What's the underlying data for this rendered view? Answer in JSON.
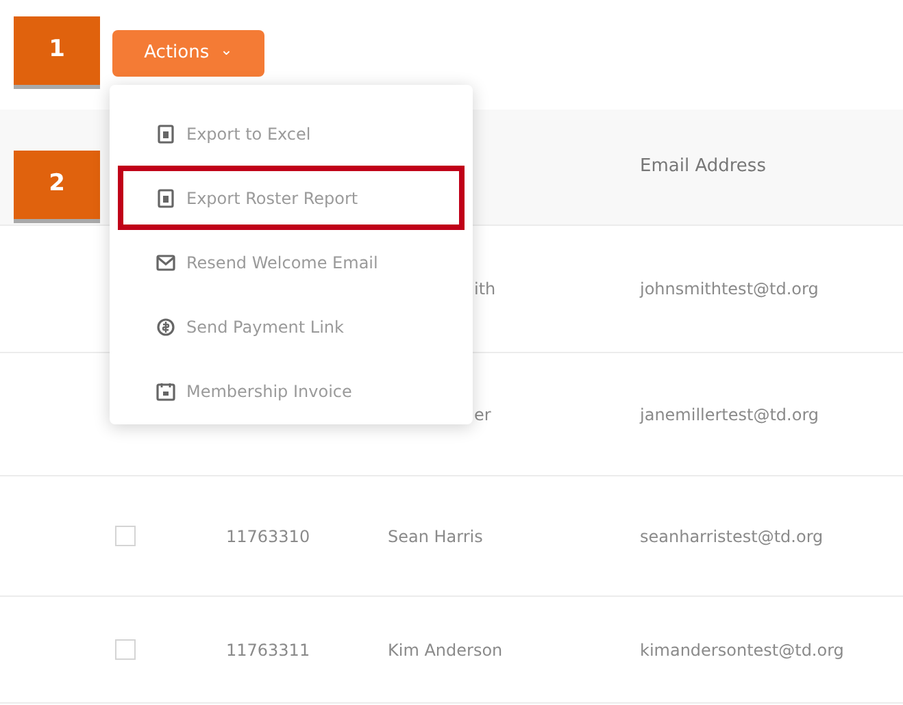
{
  "callouts": [
    "1",
    "2"
  ],
  "actions_button": {
    "label": "Actions",
    "caret": "⌄"
  },
  "menu": {
    "items": [
      {
        "label": "Export to Excel",
        "kind": "file",
        "highlighted": false
      },
      {
        "label": "Export Roster Report",
        "kind": "file",
        "highlighted": true
      },
      {
        "label": "Resend Welcome Email",
        "kind": "mail",
        "highlighted": false
      },
      {
        "label": "Send Payment Link",
        "kind": "coin",
        "highlighted": false
      },
      {
        "label": "Membership Invoice",
        "kind": "invoice",
        "highlighted": false
      }
    ]
  },
  "table": {
    "columns": [
      "Email Address"
    ],
    "rows": [
      {
        "name": "ith",
        "email": "johnsmithtest@td.org"
      },
      {
        "name": "er",
        "email": "janemillertest@td.org"
      },
      {
        "checked": false,
        "id": "11763310",
        "name": "Sean Harris",
        "email": "seanharristest@td.org"
      },
      {
        "checked": false,
        "id": "11763311",
        "name": "Kim Anderson",
        "email": "kimandersontest@td.org"
      }
    ]
  }
}
